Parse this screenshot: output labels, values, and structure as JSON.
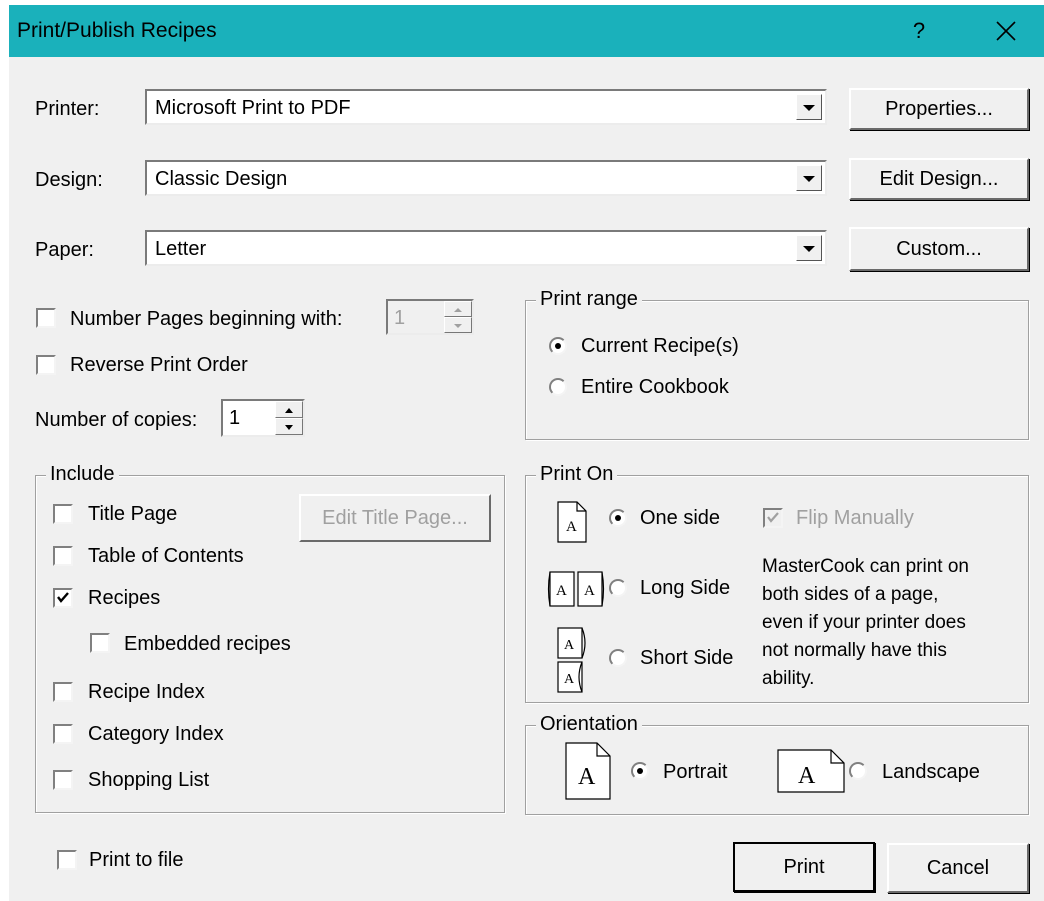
{
  "window": {
    "title": "Print/Publish Recipes",
    "help_glyph": "?"
  },
  "printer": {
    "label": "Printer:",
    "value": "Microsoft Print to PDF",
    "button": "Properties..."
  },
  "design": {
    "label": "Design:",
    "value": "Classic Design",
    "button": "Edit Design..."
  },
  "paper": {
    "label": "Paper:",
    "value": "Letter",
    "button": "Custom..."
  },
  "options": {
    "number_pages_label": "Number Pages beginning with:",
    "number_pages_checked": false,
    "number_pages_value": "1",
    "reverse_label": "Reverse Print Order",
    "reverse_checked": false,
    "copies_label": "Number of copies:",
    "copies_value": "1"
  },
  "print_range": {
    "title": "Print range",
    "current": "Current Recipe(s)",
    "entire": "Entire Cookbook",
    "selected": "current"
  },
  "include": {
    "title": "Include",
    "edit_title_page": "Edit Title Page...",
    "items": [
      {
        "label": "Title Page",
        "checked": false
      },
      {
        "label": "Table of Contents",
        "checked": false
      },
      {
        "label": "Recipes",
        "checked": true
      },
      {
        "label": "Embedded recipes",
        "checked": false
      },
      {
        "label": "Recipe Index",
        "checked": false
      },
      {
        "label": "Category Index",
        "checked": false
      },
      {
        "label": "Shopping List",
        "checked": false
      }
    ]
  },
  "print_on": {
    "title": "Print On",
    "one_side": "One side",
    "long_side": "Long Side",
    "short_side": "Short Side",
    "selected": "one_side",
    "flip_manually": "Flip Manually",
    "flip_checked": true,
    "note_lines": [
      "MasterCook can print on",
      "both sides of a page,",
      "even if your printer does",
      "not normally have this",
      "ability."
    ],
    "icon_letter": "A"
  },
  "orientation": {
    "title": "Orientation",
    "portrait": "Portrait",
    "landscape": "Landscape",
    "selected": "portrait",
    "icon_letter": "A"
  },
  "print_to_file": {
    "label": "Print to file",
    "checked": false
  },
  "actions": {
    "print": "Print",
    "cancel": "Cancel"
  }
}
